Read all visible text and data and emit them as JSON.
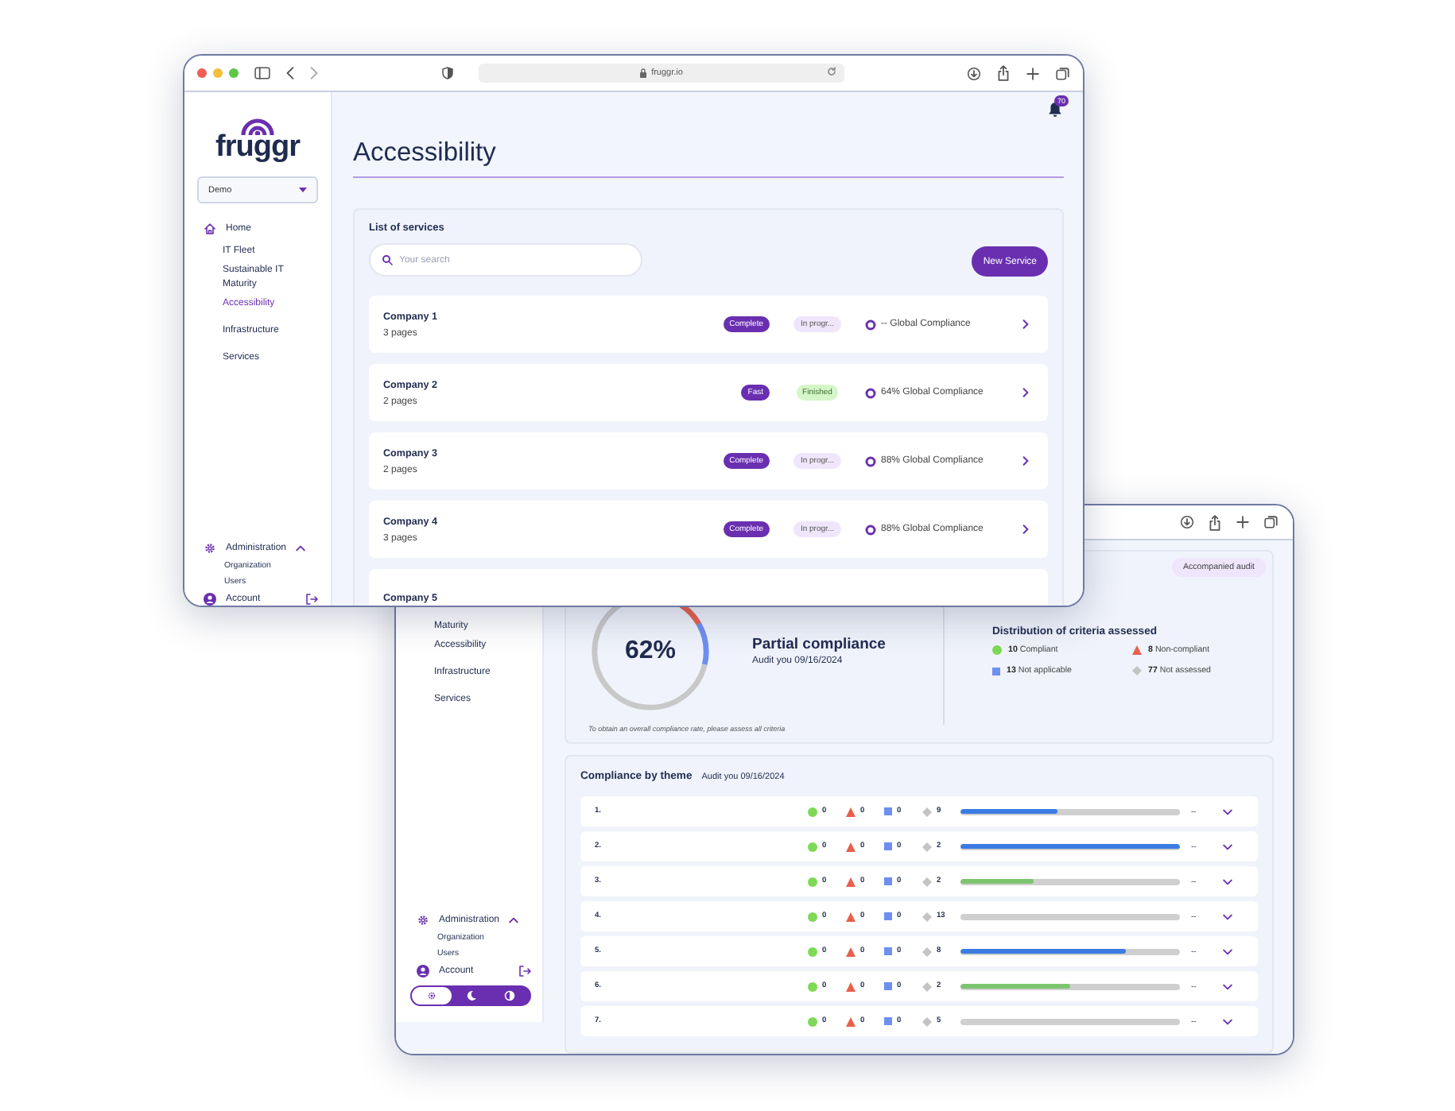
{
  "front_window": {
    "address": "fruggr.io",
    "notifications": "70",
    "sidebar": {
      "logo": "fruggr",
      "org_select": {
        "value": "Demo"
      },
      "home": "Home",
      "nav_items": [
        {
          "label": "IT Fleet",
          "selected": false
        },
        {
          "label": "Sustainable IT Maturity",
          "selected": false
        },
        {
          "label": "Accessibility",
          "selected": true
        },
        {
          "label": "Infrastructure",
          "selected": false
        },
        {
          "label": "Services",
          "selected": false
        }
      ],
      "administration": {
        "label": "Administration",
        "expanded": true,
        "items": [
          "Organization",
          "Users"
        ]
      },
      "account": "Account"
    },
    "page_title": "Accessibility",
    "services": {
      "title": "List of services",
      "search": {
        "placeholder": "Your search"
      },
      "new_button": "New Service",
      "rows": [
        {
          "name": "Company 1",
          "pages": "3 pages",
          "speed": "Complete",
          "status": {
            "label": "In progr...",
            "kind": "progress"
          },
          "compliance": "-- Global Compliance"
        },
        {
          "name": "Company 2",
          "pages": "2 pages",
          "speed": "Fast",
          "status": {
            "label": "Finished",
            "kind": "done"
          },
          "compliance": "64% Global Compliance"
        },
        {
          "name": "Company 3",
          "pages": "2 pages",
          "speed": "Complete",
          "status": {
            "label": "In progr...",
            "kind": "progress"
          },
          "compliance": "88% Global Compliance"
        },
        {
          "name": "Company 4",
          "pages": "3 pages",
          "speed": "Complete",
          "status": {
            "label": "In progr...",
            "kind": "progress"
          },
          "compliance": "88% Global Compliance"
        },
        {
          "name": "Company 5"
        }
      ]
    }
  },
  "back_window": {
    "sidebar": {
      "nav_items": [
        {
          "label": "Maturity",
          "selected": false
        },
        {
          "label": "Accessibility",
          "selected": false
        },
        {
          "label": "Infrastructure",
          "selected": false
        },
        {
          "label": "Services",
          "selected": false
        }
      ],
      "administration": {
        "label": "Administration",
        "expanded": true,
        "items": [
          "Organization",
          "Users"
        ]
      },
      "account": "Account",
      "theme_switch": [
        {
          "kind": "light",
          "selected": true
        },
        {
          "kind": "dark",
          "selected": false
        },
        {
          "kind": "contrast",
          "selected": false
        }
      ]
    },
    "summary": {
      "badge": "Accompanied audit",
      "score": "62%",
      "status": "Partial compliance",
      "audit_date": "Audit you 09/16/2024",
      "distribution": {
        "title": "Distribution of criteria assessed",
        "items": [
          {
            "kind": "compliant",
            "count": "10",
            "label": "Compliant"
          },
          {
            "kind": "non_compliant",
            "count": "8",
            "label": "Non-compliant"
          },
          {
            "kind": "not_applicable",
            "count": "13",
            "label": "Not applicable"
          },
          {
            "kind": "not_assessed",
            "count": "77",
            "label": "Not assessed"
          }
        ]
      },
      "note": "To obtain an overall compliance rate, please assess all criteria"
    },
    "themes": {
      "title": "Compliance by theme",
      "audit_date": "Audit you 09/16/2024",
      "rows": [
        {
          "number": "1.",
          "compliant": "0",
          "non_compliant": "0",
          "not_applicable": "0",
          "not_assessed": "9",
          "level": 0.44,
          "color": "#3b7be2",
          "score": "--"
        },
        {
          "number": "2.",
          "compliant": "0",
          "non_compliant": "0",
          "not_applicable": "0",
          "not_assessed": "2",
          "level": 1,
          "color": "#3b7be2",
          "score": "--"
        },
        {
          "number": "3.",
          "compliant": "0",
          "non_compliant": "0",
          "not_applicable": "0",
          "not_assessed": "2",
          "level": 0.33,
          "color": "#7dc46f",
          "score": "--"
        },
        {
          "number": "4.",
          "compliant": "0",
          "non_compliant": "0",
          "not_applicable": "0",
          "not_assessed": "13",
          "score": "--"
        },
        {
          "number": "5.",
          "compliant": "0",
          "non_compliant": "0",
          "not_applicable": "0",
          "not_assessed": "8",
          "level": 0.75,
          "color": "#3b7be2",
          "score": "--"
        },
        {
          "number": "6.",
          "compliant": "0",
          "non_compliant": "0",
          "not_applicable": "0",
          "not_assessed": "2",
          "level": 0.5,
          "color": "#7dc46f",
          "score": "--"
        },
        {
          "number": "7.",
          "compliant": "0",
          "non_compliant": "0",
          "not_applicable": "0",
          "not_assessed": "5",
          "score": "--"
        }
      ]
    }
  }
}
